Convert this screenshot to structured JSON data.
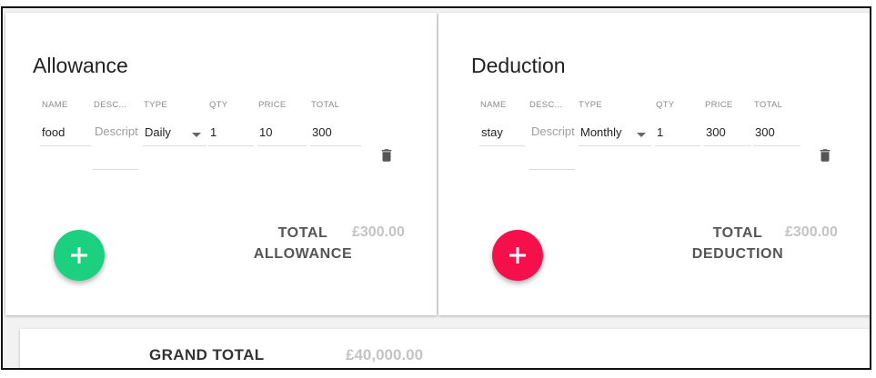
{
  "allowance": {
    "title": "Allowance",
    "headers": {
      "name": "NAME",
      "description": "DESC...",
      "type": "TYPE",
      "qty": "QTY",
      "price": "PRICE",
      "total": "TOTAL"
    },
    "row": {
      "name": "food",
      "description_placeholder": "Description",
      "type": "Daily",
      "qty": "1",
      "price": "10",
      "total": "300"
    },
    "total_label": "TOTAL ALLOWANCE",
    "total_amount": "£300.00",
    "add_button_color": "#1dd07f"
  },
  "deduction": {
    "title": "Deduction",
    "headers": {
      "name": "NAME",
      "description": "DESC...",
      "type": "TYPE",
      "qty": "QTY",
      "price": "PRICE",
      "total": "TOTAL"
    },
    "row": {
      "name": "stay",
      "description_placeholder": "Description",
      "type": "Monthly",
      "qty": "1",
      "price": "300",
      "total": "300"
    },
    "total_label": "TOTAL DEDUCTION",
    "total_amount": "£300.00",
    "add_button_color": "#f5104c"
  },
  "grand_total": {
    "label": "GRAND TOTAL",
    "amount": "£40,000.00"
  },
  "icons": {
    "delete": "trash-icon",
    "add": "plus-icon",
    "dropdown": "caret-down-icon"
  }
}
